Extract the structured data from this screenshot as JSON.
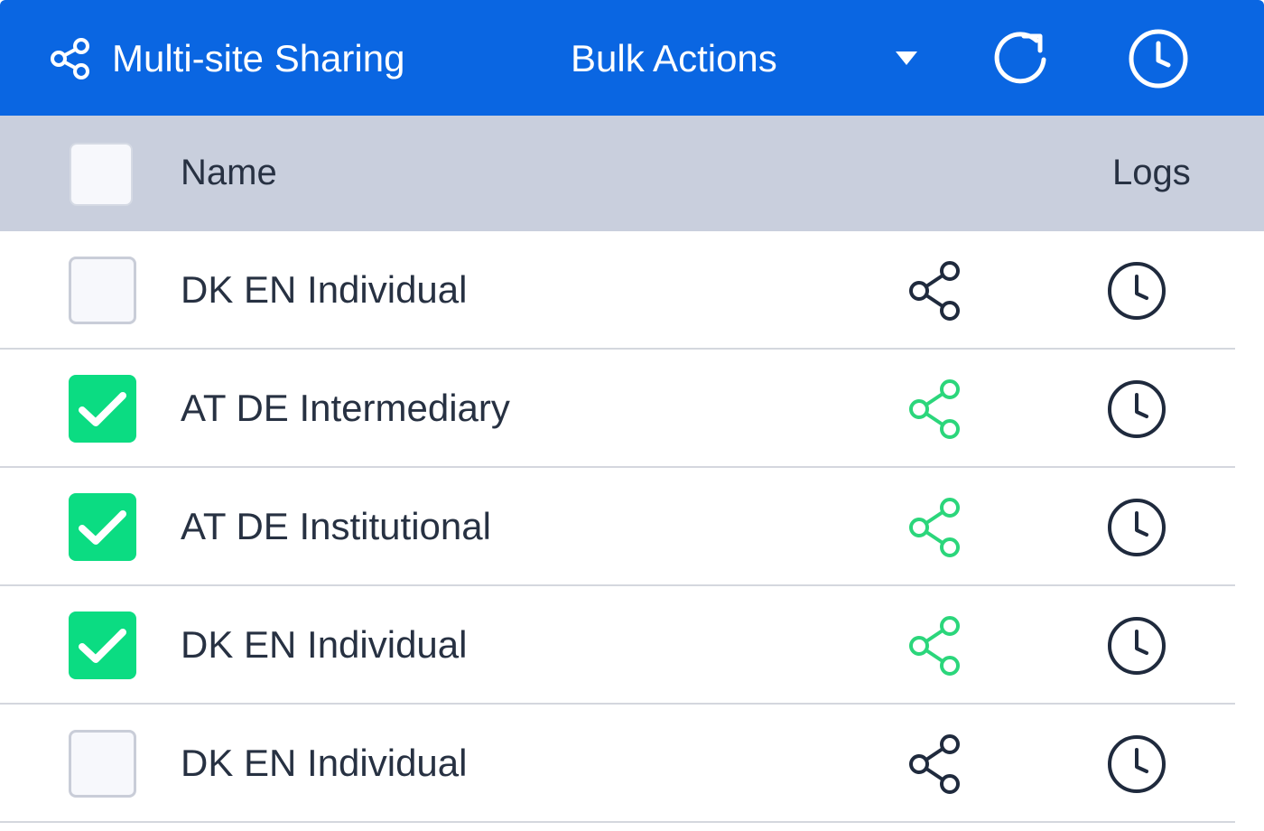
{
  "toolbar": {
    "title": "Multi-site Sharing",
    "title_icon": "share-icon",
    "bulk_actions_label": "Bulk Actions",
    "refresh_icon": "refresh-icon",
    "history_icon": "clock-icon",
    "background": "#0A66E2"
  },
  "table": {
    "header": {
      "name_label": "Name",
      "logs_label": "Logs"
    },
    "rows": [
      {
        "name": "DK EN Individual",
        "checked": false,
        "share_color": "#1F2A3D"
      },
      {
        "name": "AT DE Intermediary",
        "checked": true,
        "share_color": "#2BD67B"
      },
      {
        "name": "AT DE Institutional",
        "checked": true,
        "share_color": "#2BD67B"
      },
      {
        "name": "DK EN Individual",
        "checked": true,
        "share_color": "#2BD67B"
      },
      {
        "name": "DK EN Individual",
        "checked": false,
        "share_color": "#1F2A3D"
      }
    ]
  },
  "colors": {
    "accent": "#0A66E2",
    "checked": "#0BDC82",
    "header_bg": "#C9CFDD",
    "icon_dark": "#1F2A3D"
  }
}
